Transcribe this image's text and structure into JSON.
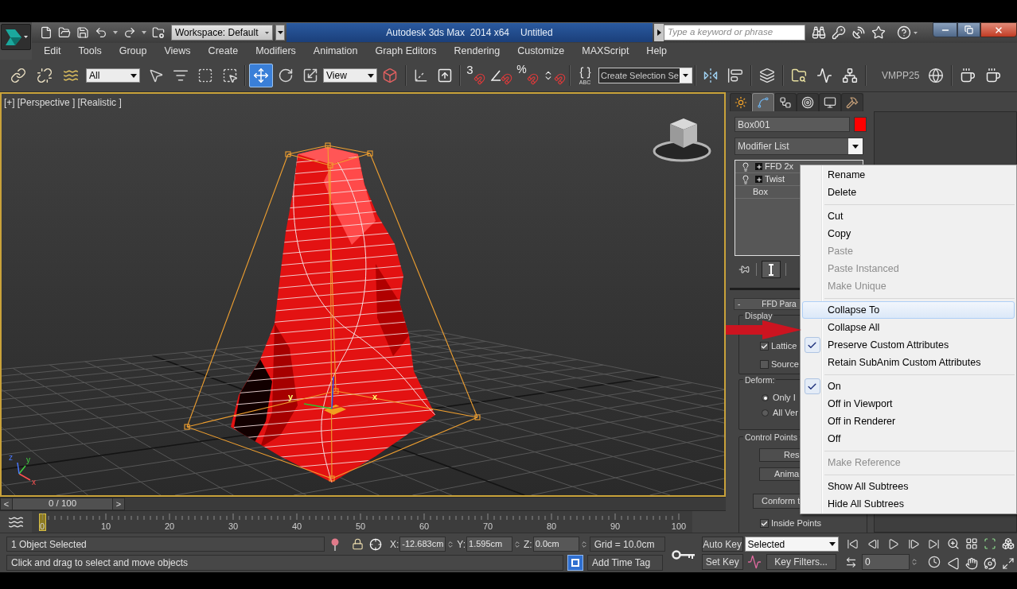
{
  "title_bar": {
    "workspace": "Workspace: Default",
    "app_name": "Autodesk 3ds Max  2014 x64",
    "document": "Untitled",
    "search": {
      "placeholder": "Type a keyword or phrase"
    }
  },
  "menu_bar": [
    "Edit",
    "Tools",
    "Group",
    "Views",
    "Create",
    "Modifiers",
    "Animation",
    "Graph Editors",
    "Rendering",
    "Customize",
    "MAXScript",
    "Help"
  ],
  "main_toolbar": {
    "selection_filter": "All",
    "tools": [
      {
        "kind": "select_object",
        "selected": false
      },
      {
        "kind": "select_by_name",
        "selected": false
      },
      {
        "kind": "region_select",
        "selected": false
      },
      {
        "kind": "window_crossing",
        "selected": false
      },
      {
        "kind": "move",
        "selected": true
      },
      {
        "kind": "rotate",
        "selected": false
      },
      {
        "kind": "scale",
        "selected": false
      }
    ],
    "reference_coordinate": "View",
    "snap_labels": [
      "3",
      "%"
    ],
    "named_sets_label": "ABC",
    "named_selection": "Create Selection Se",
    "plugin_label": "VMPP25"
  },
  "viewport": {
    "active": true,
    "labels": [
      "[+]",
      "[Perspective ]",
      "[Realistic ]"
    ],
    "gizmo_labels": [
      "y",
      "x"
    ],
    "tripod_labels": [
      "z",
      "y",
      "x"
    ]
  },
  "command_panel": {
    "tabs": [
      {
        "kind": "create",
        "selected": false
      },
      {
        "kind": "modify",
        "selected": true
      },
      {
        "kind": "hierarchy",
        "selected": false
      },
      {
        "kind": "motion",
        "selected": false
      },
      {
        "kind": "display",
        "selected": false
      },
      {
        "kind": "utilities",
        "selected": false
      }
    ],
    "object_name": "Box001",
    "modifier_list": "Modifier List",
    "stack": [
      {
        "kind": "modifier",
        "label": "FFD 2x"
      },
      {
        "kind": "modifier",
        "label": "Twist"
      },
      {
        "kind": "base",
        "label": "Box"
      }
    ],
    "show_end_result": true,
    "rollout": {
      "toggle": "-",
      "title": "FFD Para",
      "groups": [
        {
          "label": "Display",
          "controls": [
            {
              "kind": "checkbox",
              "label": "Lattice",
              "checked": true
            },
            {
              "kind": "checkbox",
              "label": "Source",
              "checked": false
            }
          ]
        },
        {
          "label": "Deform:",
          "controls": [
            {
              "kind": "radio",
              "label": "Only I",
              "selected": true
            },
            {
              "kind": "radio",
              "label": "All Ver",
              "selected": false
            }
          ]
        },
        {
          "label": "Control Points",
          "controls": [
            {
              "kind": "button",
              "label": "Res"
            },
            {
              "kind": "button",
              "label": "Anima"
            },
            {
              "kind": "button",
              "label": "Conform t"
            },
            {
              "kind": "checkbox",
              "label": "Inside Points",
              "checked": true
            }
          ]
        }
      ]
    }
  },
  "context_menu": {
    "groups": [
      [
        {
          "label": "Rename",
          "disabled": false,
          "checked": false,
          "selected": false
        },
        {
          "label": "Delete",
          "disabled": false,
          "checked": false,
          "selected": false
        }
      ],
      [
        {
          "label": "Cut",
          "disabled": false,
          "checked": false,
          "selected": false
        },
        {
          "label": "Copy",
          "disabled": false,
          "checked": false,
          "selected": false
        },
        {
          "label": "Paste",
          "disabled": true,
          "checked": false,
          "selected": false
        },
        {
          "label": "Paste Instanced",
          "disabled": true,
          "checked": false,
          "selected": false
        },
        {
          "label": "Make Unique",
          "disabled": true,
          "checked": false,
          "selected": false
        }
      ],
      [
        {
          "label": "Collapse To",
          "disabled": false,
          "checked": false,
          "selected": true
        },
        {
          "label": "Collapse All",
          "disabled": false,
          "checked": false,
          "selected": false
        },
        {
          "label": "Preserve Custom Attributes",
          "disabled": false,
          "checked": true,
          "selected": false
        },
        {
          "label": "Retain SubAnim Custom Attributes",
          "disabled": false,
          "checked": false,
          "selected": false
        }
      ],
      [
        {
          "label": "On",
          "disabled": false,
          "checked": true,
          "selected": false
        },
        {
          "label": "Off in Viewport",
          "disabled": false,
          "checked": false,
          "selected": false
        },
        {
          "label": "Off in Renderer",
          "disabled": false,
          "checked": false,
          "selected": false
        },
        {
          "label": "Off",
          "disabled": false,
          "checked": false,
          "selected": false
        }
      ],
      [
        {
          "label": "Make Reference",
          "disabled": true,
          "checked": false,
          "selected": false
        }
      ],
      [
        {
          "label": "Show All Subtrees",
          "disabled": false,
          "checked": false,
          "selected": false
        },
        {
          "label": "Hide All Subtrees",
          "disabled": false,
          "checked": false,
          "selected": false
        }
      ]
    ]
  },
  "time_slider": {
    "prev": "<",
    "label": "0 / 100",
    "next": ">",
    "level": 0
  },
  "track_bar": {
    "level": 0,
    "labels": [
      "0",
      "10",
      "20",
      "30",
      "40",
      "50",
      "60",
      "70",
      "80",
      "90",
      "100"
    ]
  },
  "status_bar": {
    "selection": "1 Object Selected",
    "prompt": "Click and drag to select and move objects",
    "coordinates": [
      {
        "axis": "X:",
        "value": "-12.683cm"
      },
      {
        "axis": "Y:",
        "value": "1.595cm"
      },
      {
        "axis": "Z:",
        "value": "0.0cm"
      }
    ],
    "grid": "Grid = 10.0cm",
    "time_tag": "Add Time Tag",
    "auto_key": {
      "label": "Auto Key",
      "on": false
    },
    "set_key": "Set Key",
    "key_set": "Selected",
    "key_filters": "Key Filters...",
    "frame": "0"
  }
}
